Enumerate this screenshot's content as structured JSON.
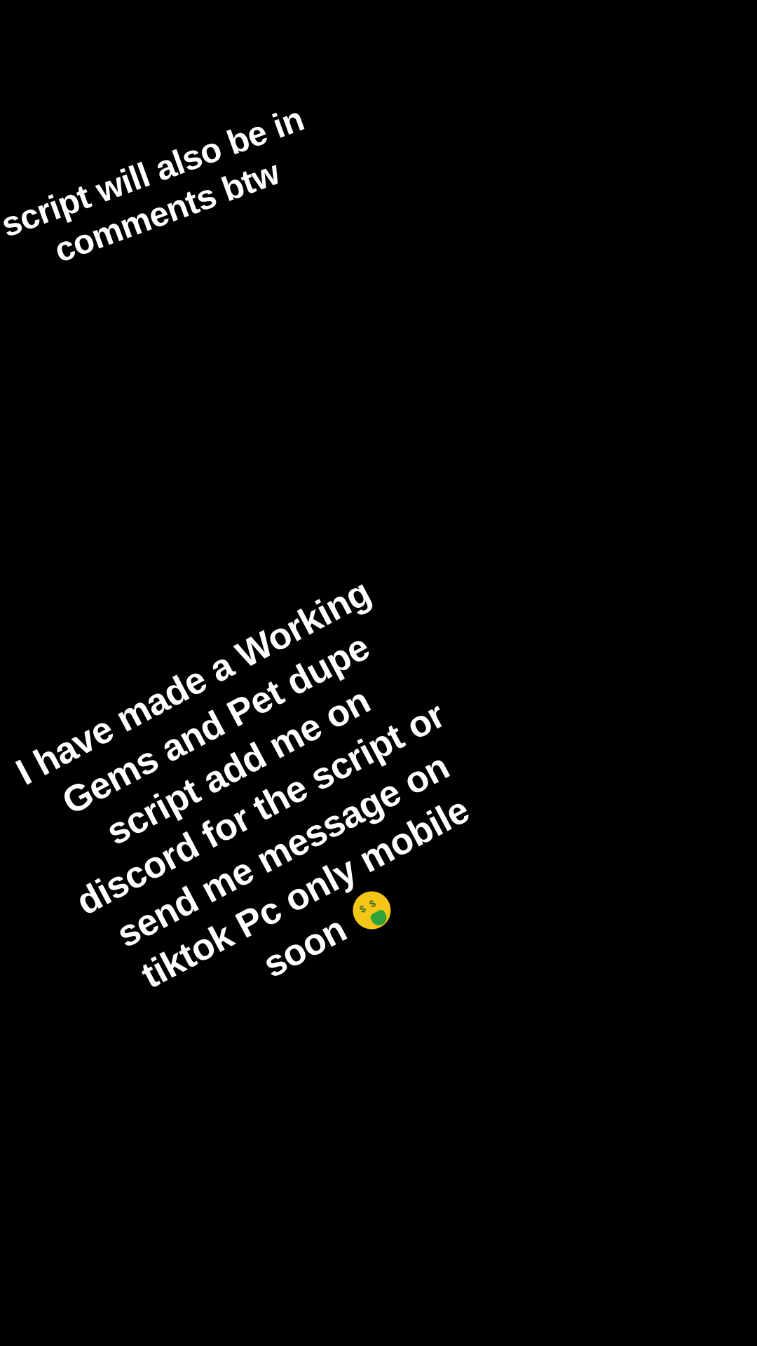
{
  "top_caption": {
    "lines": [
      "script will also be in",
      "comments btw"
    ]
  },
  "main_caption": {
    "lines": [
      "I have made a Working",
      "Gems and Pet dupe",
      "script add me on",
      "discord for the script or",
      "send me message on",
      "tiktok Pc only mobile",
      "soon"
    ],
    "emoji": "money-mouth-face-icon"
  },
  "colors": {
    "background": "#000000",
    "text": "#ffffff"
  }
}
